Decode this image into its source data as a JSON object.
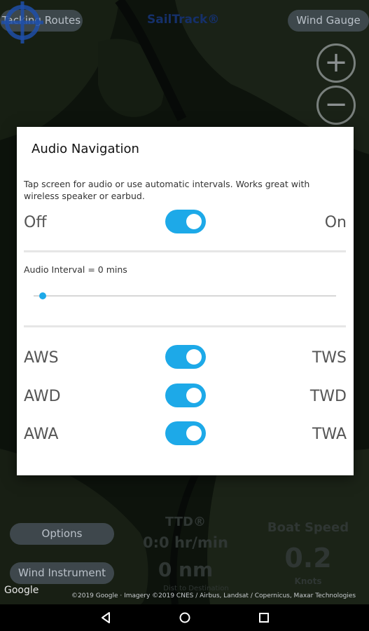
{
  "top_bar": {
    "left_button": "Tacking Routes",
    "title": "SailTrack®",
    "right_button": "Wind Gauge"
  },
  "zoom": {
    "in_symbol": "+",
    "out_symbol": "−"
  },
  "bottom_panel": {
    "options_button": "Options",
    "wind_instrument_button": "Wind Instrument",
    "ttd_label": "TTD®",
    "ttd_value": "0:0 hr/min",
    "distance_value": "0 nm",
    "distance_caption": "Dist to Destination",
    "boat_speed_label": "Boat Speed",
    "boat_speed_value": "0.2",
    "boat_speed_unit": "Knots"
  },
  "map_footer": {
    "google_logo": "Google",
    "attribution": "©2019 Google · Imagery ©2019 CNES / Airbus, Landsat / Copernicus, Maxar Technologies"
  },
  "dialog": {
    "title": "Audio Navigation",
    "description": "Tap screen for audio or use automatic intervals. Works great with wireless speaker or earbud.",
    "master": {
      "off_label": "Off",
      "on_label": "On",
      "state": "on"
    },
    "interval_label": "Audio Interval = 0 mins",
    "interval_value": 0,
    "rows": [
      {
        "left": "AWS",
        "right": "TWS",
        "state": "on"
      },
      {
        "left": "AWD",
        "right": "TWD",
        "state": "on"
      },
      {
        "left": "AWA",
        "right": "TWA",
        "state": "on"
      }
    ]
  },
  "colors": {
    "accent": "#1da9e8",
    "dialog_bg": "#ffffff",
    "navbar": "#000000"
  },
  "navbar": {
    "back_icon": "back-triangle-icon",
    "home_icon": "home-circle-icon",
    "recents_icon": "recents-square-icon"
  }
}
